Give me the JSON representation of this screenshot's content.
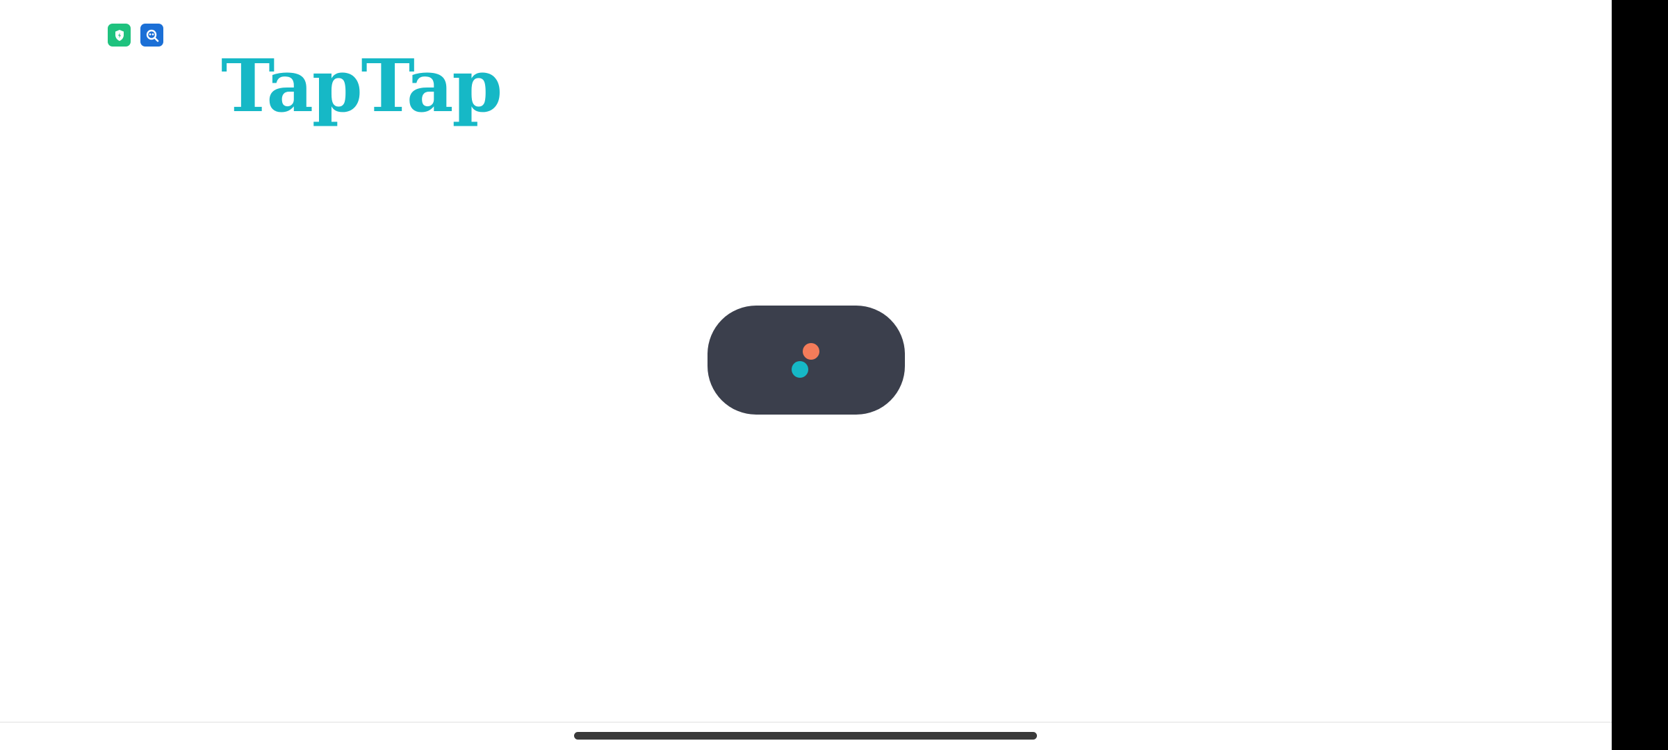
{
  "app": {
    "logo_text": "TapTap"
  },
  "status_bar": {
    "icons": [
      {
        "name": "shield-icon",
        "color": "#1fc27e"
      },
      {
        "name": "search-lens-icon",
        "color": "#1b6fd6"
      }
    ]
  },
  "loading": {
    "dots": [
      {
        "name": "orange-dot",
        "color": "#f47c5a"
      },
      {
        "name": "teal-dot",
        "color": "#16b8c6"
      }
    ]
  },
  "colors": {
    "brand": "#16b8c6",
    "pill": "#3b3f4c",
    "background": "#ffffff"
  }
}
